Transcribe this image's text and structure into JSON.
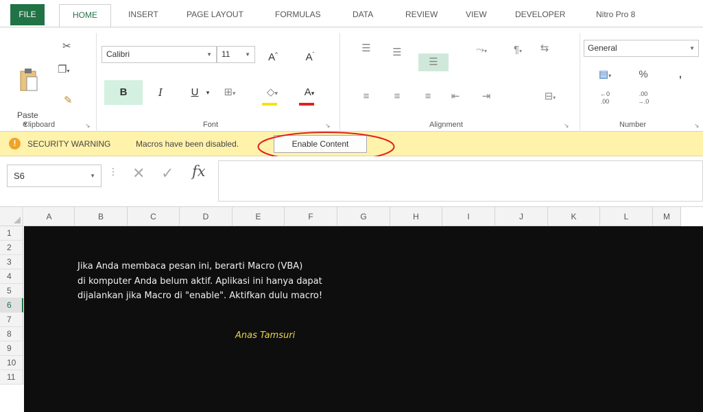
{
  "ribbon_tabs": {
    "file": "FILE",
    "home": "HOME",
    "insert": "INSERT",
    "page_layout": "PAGE LAYOUT",
    "formulas": "FORMULAS",
    "data": "DATA",
    "review": "REVIEW",
    "view": "VIEW",
    "developer": "DEVELOPER",
    "nitro": "Nitro Pro 8"
  },
  "clipboard": {
    "paste_label": "Paste",
    "group_label": "Clipboard"
  },
  "font": {
    "name": "Calibri",
    "size": "11",
    "group_label": "Font",
    "bold": "B",
    "italic": "I",
    "underline": "U",
    "grow": "A",
    "shrink": "A",
    "font_color_glyph": "A"
  },
  "alignment": {
    "group_label": "Alignment"
  },
  "number": {
    "format": "General",
    "percent": "%",
    "comma": ",",
    "group_label": "Number"
  },
  "security_bar": {
    "title": "SECURITY WARNING",
    "message": "Macros have been disabled.",
    "button_label": "Enable Content"
  },
  "formula_bar": {
    "name_box": "S6",
    "fx_label": "fx"
  },
  "sheet": {
    "columns": [
      "A",
      "B",
      "C",
      "D",
      "E",
      "F",
      "G",
      "H",
      "I",
      "J",
      "K",
      "L",
      "M"
    ],
    "rows": [
      "1",
      "2",
      "3",
      "4",
      "5",
      "6",
      "7",
      "8",
      "9",
      "10",
      "11"
    ],
    "active_row": "6",
    "message_lines": [
      "Jika Anda membaca pesan ini, berarti Macro (VBA)",
      "di komputer Anda belum aktif. Aplikasi ini hanya dapat",
      "dijalankan jika Macro di \"enable\". Aktifkan dulu macro!"
    ],
    "author": "Anas Tamsuri"
  },
  "colors": {
    "excel_green": "#217346",
    "sheet_background": "#0e0e0e",
    "warning_bar": "#fff2ab",
    "highlight_circle": "#e02020",
    "author_text": "#e8d44d"
  }
}
